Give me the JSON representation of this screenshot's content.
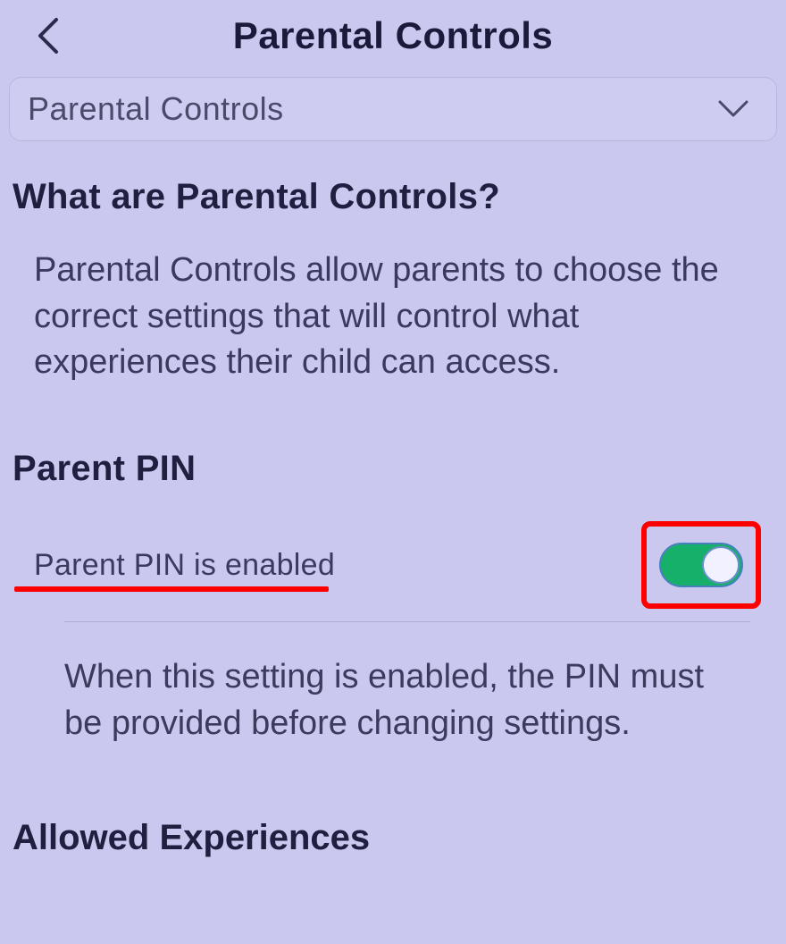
{
  "header": {
    "title": "Parental Controls"
  },
  "dropdown": {
    "label": "Parental Controls"
  },
  "intro": {
    "heading": "What are Parental Controls?",
    "body": "Parental Controls allow parents to choose the correct settings that will control what experiences their child can access."
  },
  "pin": {
    "heading": "Parent PIN",
    "row_label": "Parent PIN is enabled",
    "toggle_on": true,
    "description": "When this setting is enabled, the PIN must be provided before changing settings."
  },
  "allowed": {
    "heading": "Allowed Experiences"
  },
  "annotations": {
    "underline_color": "#ff0000",
    "box_color": "#ff0000"
  }
}
